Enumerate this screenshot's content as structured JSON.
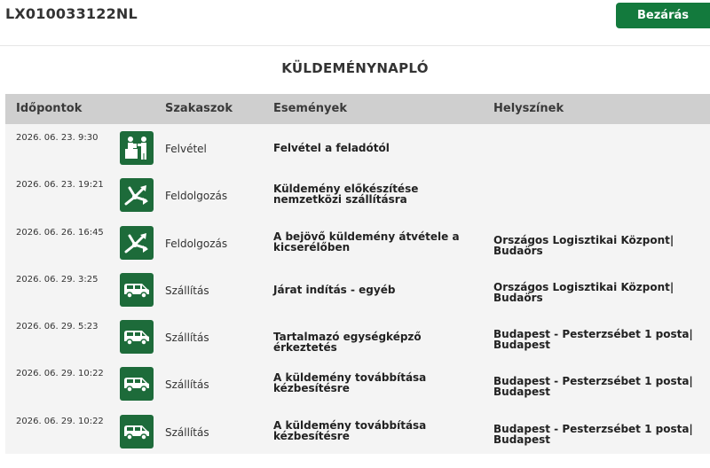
{
  "header": {
    "tracking_id": "LX010033122NL",
    "close_label": "Bezárás"
  },
  "page_title": "KÜLDEMÉNYNAPLÓ",
  "table": {
    "columns": [
      "Időpontok",
      "Szakaszok",
      "Események",
      "Helyszínek"
    ],
    "rows": [
      {
        "time": "2026. 06. 23. 9:30",
        "icon": "handover-icon",
        "stage": "Felvétel",
        "event": "Felvétel a feladótól",
        "location": ""
      },
      {
        "time": "2026. 06. 23. 19:21",
        "icon": "sorting-icon",
        "stage": "Feldolgozás",
        "event": "Küldemény előkészítése nemzetközi szállításra",
        "location": ""
      },
      {
        "time": "2026. 06. 26. 16:45",
        "icon": "sorting-icon",
        "stage": "Feldolgozás",
        "event": "A bejövő küldemény átvétele a kicserélőben",
        "location": "Országos Logisztikai Központ| Budaörs"
      },
      {
        "time": "2026. 06. 29. 3:25",
        "icon": "van-icon",
        "stage": "Szállítás",
        "event": "Járat indítás - egyéb",
        "location": "Országos Logisztikai Központ| Budaörs"
      },
      {
        "time": "2026. 06. 29. 5:23",
        "icon": "van-icon",
        "stage": "Szállítás",
        "event": "Tartalmazó egységképző érkeztetés",
        "location": "Budapest - Pesterzsébet 1 posta| Budapest"
      },
      {
        "time": "2026. 06. 29. 10:22",
        "icon": "van-icon",
        "stage": "Szállítás",
        "event": "A küldemény továbbítása kézbesítésre",
        "location": "Budapest - Pesterzsébet 1 posta| Budapest"
      },
      {
        "time": "2026. 06. 29. 10:22",
        "icon": "van-icon",
        "stage": "Szállítás",
        "event": "A küldemény továbbítása kézbesítésre",
        "location": "Budapest - Pesterzsébet 1 posta| Budapest"
      }
    ]
  },
  "colors": {
    "accent": "#137a3d",
    "icon_bg": "#1d6b3a",
    "header_bg": "#cfcfcf",
    "table_bg": "#f4f4f4"
  }
}
